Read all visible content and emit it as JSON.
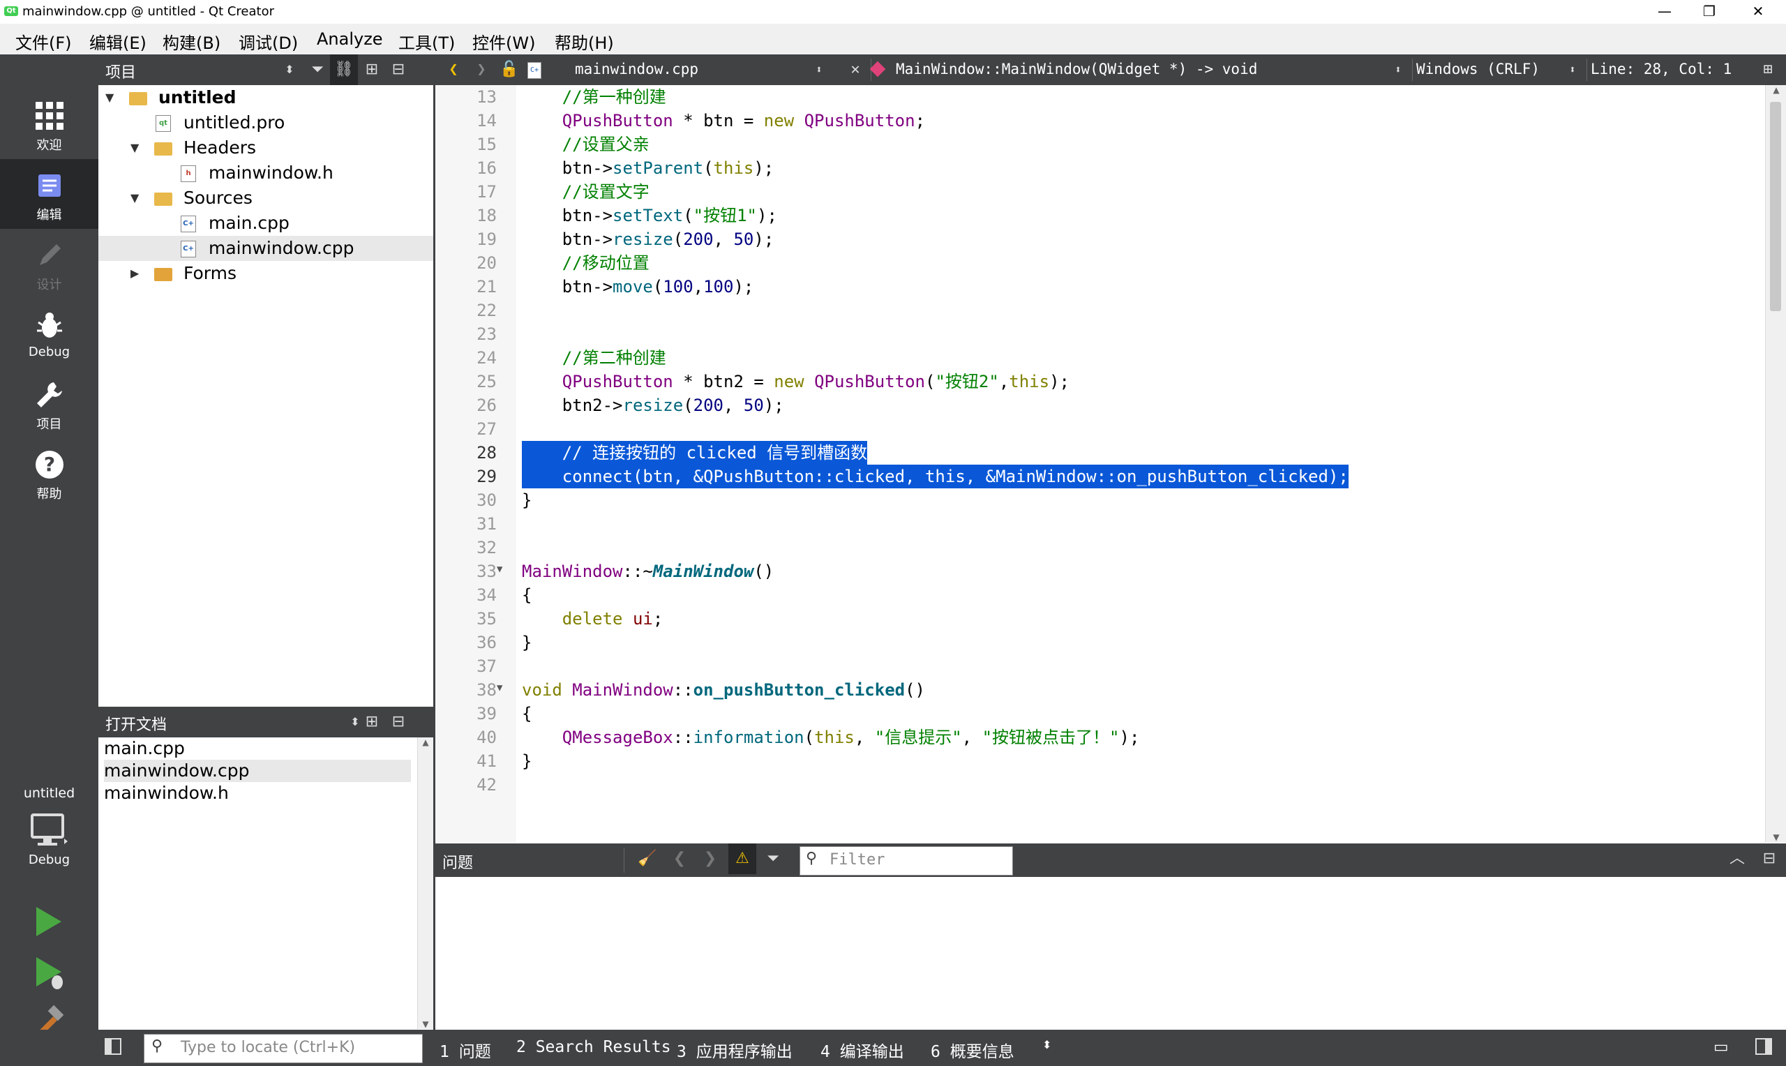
{
  "window": {
    "title": "mainwindow.cpp @ untitled - Qt Creator",
    "logo": "Qt",
    "minimize": "—",
    "restore": "❐",
    "close": "✕"
  },
  "menubar": {
    "items": [
      "文件(F)",
      "编辑(E)",
      "构建(B)",
      "调试(D)",
      "Analyze",
      "工具(T)",
      "控件(W)",
      "帮助(H)"
    ]
  },
  "modes": {
    "welcome": "欢迎",
    "edit": "编辑",
    "design": "设计",
    "debug": "Debug",
    "projects": "项目",
    "help": "帮助"
  },
  "kit": {
    "project": "untitled",
    "config": "Debug"
  },
  "project_pane": {
    "title": "项目",
    "tree": [
      "untitled",
      "untitled.pro",
      "Headers",
      "mainwindow.h",
      "Sources",
      "main.cpp",
      "mainwindow.cpp",
      "Forms"
    ]
  },
  "open_docs": {
    "title": "打开文档",
    "items": [
      "main.cpp",
      "mainwindow.cpp",
      "mainwindow.h"
    ]
  },
  "editor_bar": {
    "file": "mainwindow.cpp",
    "symbol": "MainWindow::MainWindow(QWidget *) -> void",
    "line_ending": "Windows (CRLF)",
    "position": "Line: 28, Col: 1"
  },
  "code": {
    "line_numbers": [
      "13",
      "14",
      "15",
      "16",
      "17",
      "18",
      "19",
      "20",
      "21",
      "22",
      "23",
      "24",
      "25",
      "26",
      "27",
      "28",
      "29",
      "30",
      "31",
      "32",
      "33",
      "34",
      "35",
      "36",
      "37",
      "38",
      "39",
      "40",
      "41",
      "42"
    ],
    "current_lines": [
      "28",
      "29"
    ],
    "tokens": {
      "c1": "//第一种创建",
      "QPushButton": "QPushButton",
      "star_btn": " * btn = ",
      "new": "new",
      "semi": ";",
      "c2": "//设置父亲",
      "btn_arrow": "btn->",
      "setParent": "setParent",
      "this": "this",
      "c3": "//设置文字",
      "setText": "setText",
      "s_btn1": "\"按钮1\"",
      "resize": "resize",
      "n200": "200",
      "n50": "50",
      "c4": "//移动位置",
      "move": "move",
      "n100": "100",
      "c5": "//第二种创建",
      "star_btn2": " * btn2 = ",
      "s_btn2": "\"按钮2\"",
      "btn2_arrow": "btn2->",
      "l28": "    // 连接按钮的 clicked 信号到槽函数",
      "l29": "    connect(btn, &QPushButton::clicked, this, &MainWindow::on_pushButton_clicked);",
      "close_brace": "}",
      "open_brace": "{",
      "MainWindow": "MainWindow",
      "scope_tilde": "::~",
      "scope": "::",
      "dtor": "MainWindow",
      "parens": "()",
      "delete": "delete",
      "ui": "ui",
      "void": "void",
      "slot": "on_pushButton_clicked",
      "QMessageBox": "QMessageBox",
      "information": "information",
      "s_title": "\"信息提示\"",
      "s_msg": "\"按钮被点击了！\""
    }
  },
  "issues": {
    "title": "问题",
    "filter_placeholder": "Filter"
  },
  "status": {
    "locate_placeholder": "Type to locate (Ctrl+K)",
    "tabs": [
      "1 问题",
      "2 Search Results",
      "3 应用程序输出",
      "4 编译输出",
      "6 概要信息"
    ]
  }
}
